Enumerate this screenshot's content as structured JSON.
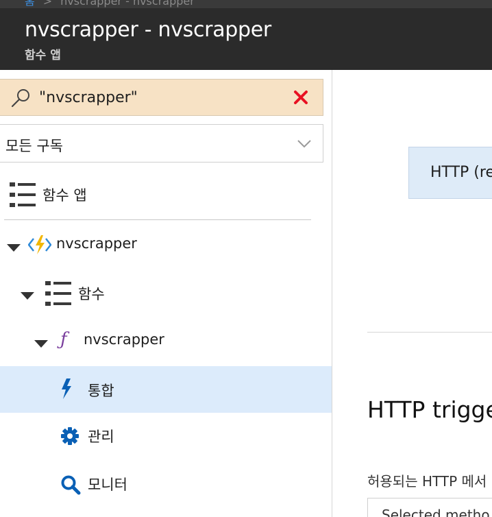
{
  "breadcrumb": {
    "home": "홈",
    "item": "nvscrapper - nvscrapper"
  },
  "header": {
    "title": "nvscrapper - nvscrapper",
    "subtitle": "함수 앱"
  },
  "sidebar": {
    "search": {
      "value": "\"nvscrapper\"",
      "icon": "search-icon",
      "clear_icon": "close-icon",
      "clear_color": "#e81123"
    },
    "subscription_filter": {
      "value": "모든 구독"
    },
    "function_apps_label": "함수 앱",
    "tree": {
      "app": "nvscrapper",
      "functions": "함수",
      "function": "nvscrapper",
      "integrate": "통합",
      "manage": "관리",
      "monitor": "모니터"
    }
  },
  "main": {
    "trigger_box": "HTTP (re",
    "section_title": "HTTP trigge",
    "allowed_methods_label": "허용되는 HTTP 메서",
    "methods_select_value": "Selected metho"
  },
  "colors": {
    "accent": "#0a60b5",
    "selected_bg": "#dcebfb",
    "topbar": "#2b2b2b",
    "search_bg": "#f7e2c5"
  }
}
